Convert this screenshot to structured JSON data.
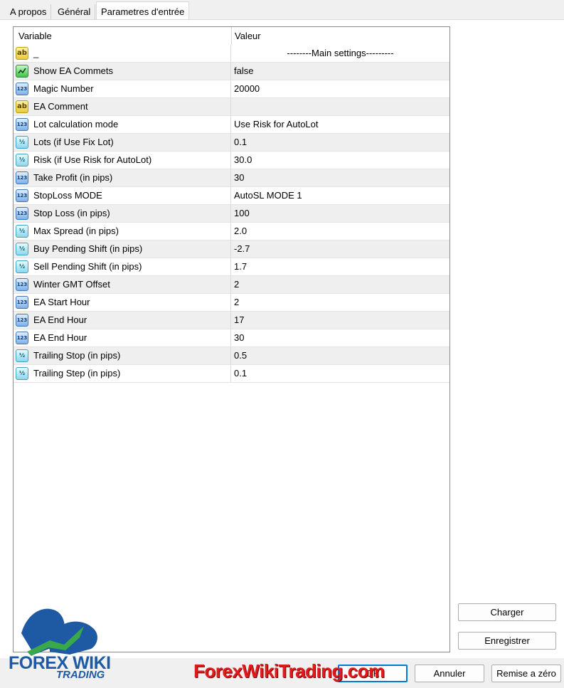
{
  "tabs": [
    {
      "label": "A propos"
    },
    {
      "label": "Général"
    },
    {
      "label": "Parametres d'entrée"
    }
  ],
  "grid": {
    "header": {
      "variable": "Variable",
      "value": "Valeur"
    },
    "rows": [
      {
        "icon": "string-icon",
        "name": "_",
        "value": "--------Main settings---------"
      },
      {
        "icon": "bool-icon",
        "name": "Show EA Commets",
        "value": "false"
      },
      {
        "icon": "integer-icon",
        "name": "Magic Number",
        "value": "20000"
      },
      {
        "icon": "string-icon",
        "name": "EA Comment",
        "value": ""
      },
      {
        "icon": "integer-icon",
        "name": "Lot calculation mode",
        "value": "Use Risk for AutoLot"
      },
      {
        "icon": "double-icon",
        "name": "Lots (if Use Fix Lot)",
        "value": "0.1"
      },
      {
        "icon": "double-icon",
        "name": "Risk (if Use Risk for AutoLot)",
        "value": "30.0"
      },
      {
        "icon": "integer-icon",
        "name": "Take Profit (in pips)",
        "value": "30"
      },
      {
        "icon": "integer-icon",
        "name": "StopLoss MODE",
        "value": "AutoSL MODE 1"
      },
      {
        "icon": "integer-icon",
        "name": "Stop Loss (in pips)",
        "value": "100"
      },
      {
        "icon": "double-icon",
        "name": "Max Spread (in pips)",
        "value": "2.0"
      },
      {
        "icon": "double-icon",
        "name": "Buy Pending Shift (in pips)",
        "value": "-2.7"
      },
      {
        "icon": "double-icon",
        "name": "Sell Pending Shift (in pips)",
        "value": "1.7"
      },
      {
        "icon": "integer-icon",
        "name": "Winter GMT Offset",
        "value": "2"
      },
      {
        "icon": "integer-icon",
        "name": "EA Start Hour",
        "value": "2"
      },
      {
        "icon": "integer-icon",
        "name": "EA End Hour",
        "value": "17"
      },
      {
        "icon": "integer-icon",
        "name": "EA End Hour",
        "value": "30"
      },
      {
        "icon": "double-icon",
        "name": "Trailing Stop (in pips)",
        "value": "0.5"
      },
      {
        "icon": "double-icon",
        "name": "Trailing Step (in pips)",
        "value": "0.1"
      }
    ]
  },
  "icon_glyphs": {
    "string": "ab",
    "integer": "123",
    "double": "½"
  },
  "side_buttons": {
    "load": "Charger",
    "save": "Enregistrer"
  },
  "footer_buttons": {
    "ok": "OK",
    "cancel": "Annuler",
    "reset": "Remise a zéro"
  },
  "watermark": {
    "site": "ForexWikiTrading.com",
    "logo_word": "FOREX WIKI",
    "logo_sub": "TRADING"
  },
  "colors": {
    "accent": "#0078d4",
    "watermark": "#e01b1b",
    "logo": "#1d5aa3"
  }
}
